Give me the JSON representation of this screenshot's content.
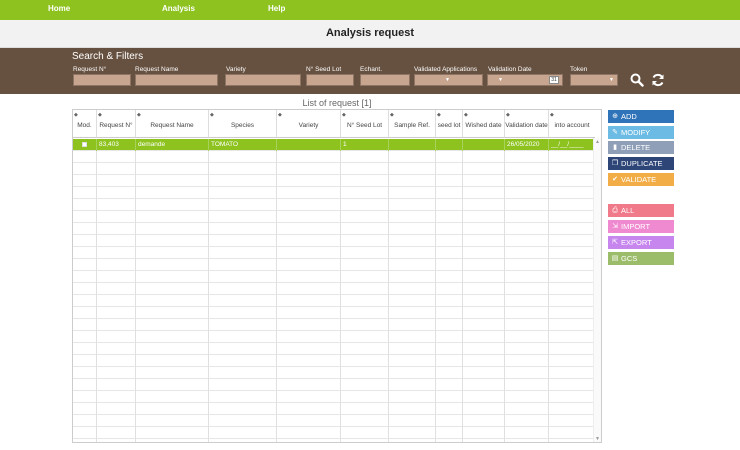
{
  "nav": {
    "home": "Home",
    "analysis": "Analysis",
    "help": "Help"
  },
  "page_title": "Analysis request",
  "filters": {
    "title": "Search & Filters",
    "request_no": "Request N°",
    "request_name": "Request Name",
    "variety": "Variety",
    "seed_lot": "N° Seed Lot",
    "echant": "Echant.",
    "validated_applications": "Validated Applications",
    "validation_date": "Validation Date",
    "token": "Token",
    "calendar_day": "31",
    "search_icon": "search-icon",
    "refresh_icon": "refresh-icon"
  },
  "list": {
    "title": "List of request [1]",
    "columns": [
      "Mod.",
      "Request N°",
      "Request Name",
      "Species",
      "Variety",
      "N° Seed Lot",
      "Sample Ref.",
      "seed lot",
      "Wished date",
      "Validation date",
      "into account"
    ],
    "rows": [
      {
        "request_no": "83,403",
        "request_name": "demande",
        "species": "TOMATO",
        "variety": "",
        "seed_lot": "1",
        "sample_ref": "",
        "seed_lot2": "",
        "wished_date": "",
        "validation_date": "26/05/2020",
        "into_account": "__/__/____"
      }
    ]
  },
  "actions": {
    "add": "ADD",
    "modify": "MODIFY",
    "delete": "DELETE",
    "duplicate": "DUPLICATE",
    "validate": "VALIDATE",
    "all": "ALL",
    "import": "IMPORT",
    "export": "EXPORT",
    "gcs": "GCS"
  },
  "colors": {
    "brand_green": "#8dc21f",
    "filter_bg": "#66503f",
    "add": "#2f73b9",
    "modify": "#6bbbe4",
    "delete": "#6c80a1",
    "duplicate": "#2e4577",
    "validate": "#f2ad46",
    "all": "#f07a89",
    "import": "#f08ad0",
    "export": "#c786ee",
    "gcs": "#9bbd6a"
  }
}
